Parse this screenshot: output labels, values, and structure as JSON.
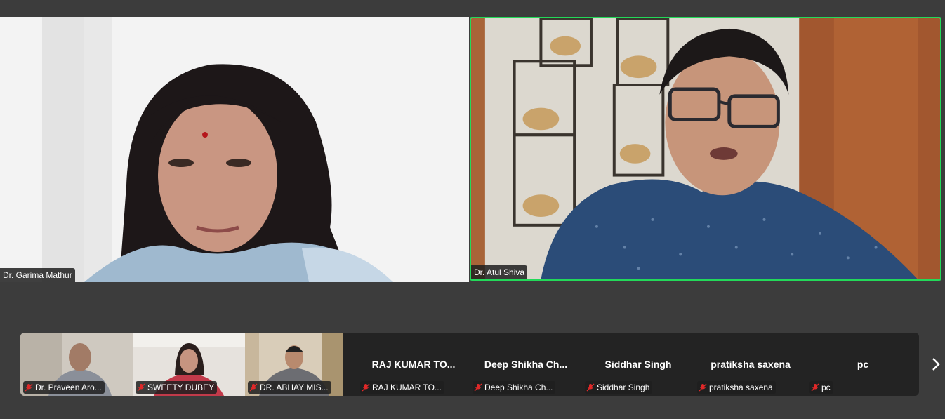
{
  "main_tiles": [
    {
      "name": "Dr. Garima Mathur",
      "speaking": false
    },
    {
      "name": "Dr. Atul Shiva",
      "speaking": true
    }
  ],
  "filmstrip": [
    {
      "name": "Dr. Praveen Aro...",
      "video": true,
      "muted": true
    },
    {
      "name": "SWEETY DUBEY",
      "video": true,
      "muted": true
    },
    {
      "name": "DR. ABHAY MIS...",
      "video": true,
      "muted": true
    },
    {
      "name": "RAJ KUMAR TO...",
      "video": false,
      "muted": true
    },
    {
      "name": "Deep  Shikha  Ch...",
      "video": false,
      "muted": true
    },
    {
      "name": "Siddhar Singh",
      "video": false,
      "muted": true
    },
    {
      "name": "pratiksha saxena",
      "video": false,
      "muted": true
    },
    {
      "name": "pc",
      "video": false,
      "muted": true
    }
  ],
  "icons": {
    "mic_off": "mic-off-icon",
    "next": "chevron-right-icon"
  },
  "colors": {
    "background": "#3c3c3c",
    "active_speaker_border": "#23d959",
    "muted_icon": "#e02828"
  }
}
